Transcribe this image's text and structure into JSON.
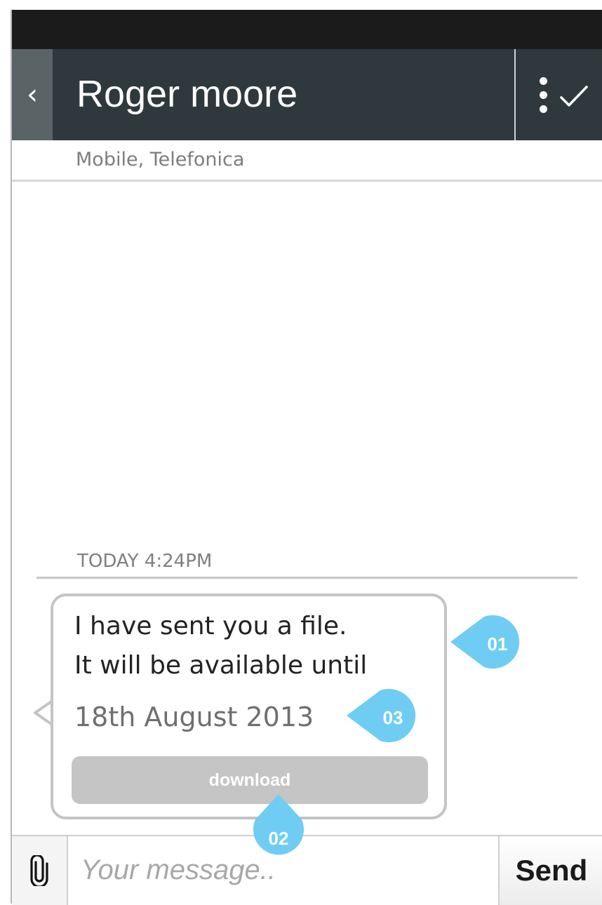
{
  "header": {
    "back_icon_char": "‹",
    "title": "Roger moore",
    "subtitle": "Mobile, Telefonica"
  },
  "conversation": {
    "date_label": "TODAY 4:24PM",
    "message": {
      "line1": "I have sent you a file.",
      "line2": "It will be available until",
      "expiry_date": "18th August 2013",
      "download_label": "download"
    }
  },
  "annotations": {
    "marker_1": "01",
    "marker_2": "02",
    "marker_3": "03",
    "color": "#6fcdf3"
  },
  "composer": {
    "placeholder": "Your message..",
    "send_label": "Send"
  }
}
